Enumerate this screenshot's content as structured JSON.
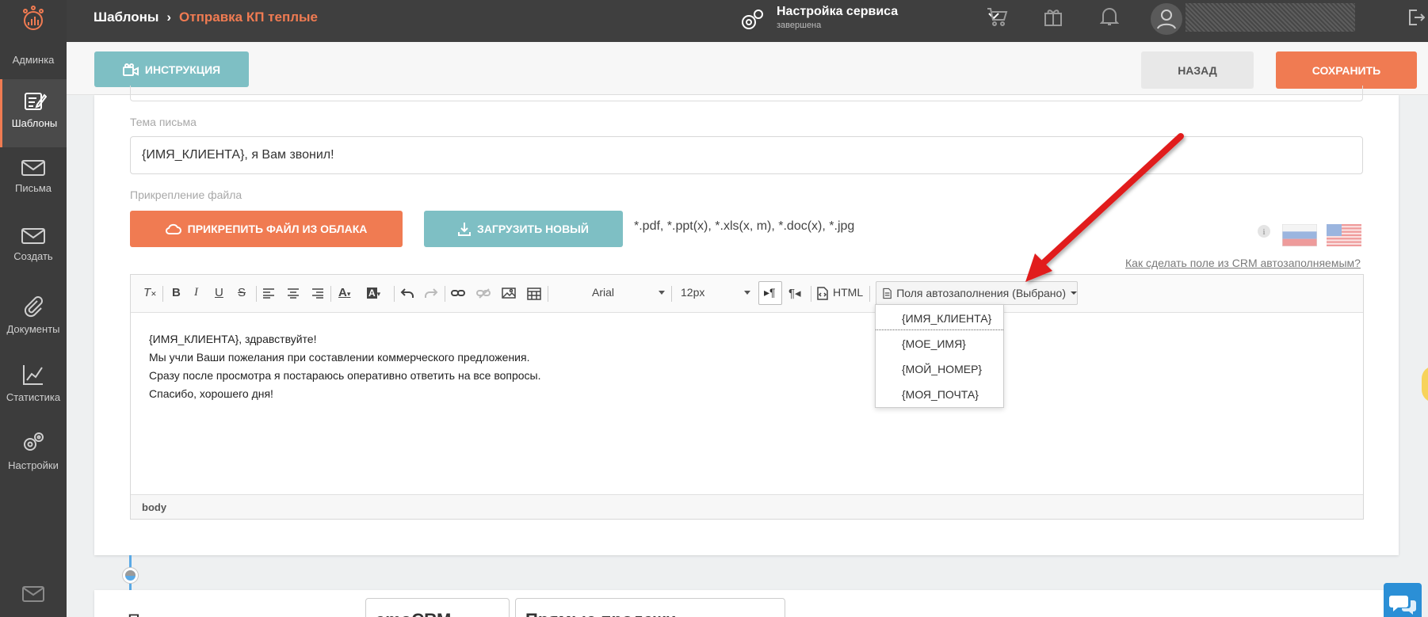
{
  "sidebar": {
    "items": [
      {
        "label": "Админка",
        "icon": "admin-logo-icon"
      },
      {
        "label": "Шаблоны",
        "icon": "templates-icon",
        "active": true
      },
      {
        "label": "Письма",
        "icon": "letters-icon"
      },
      {
        "label": "Создать",
        "icon": "create-icon"
      },
      {
        "label": "Документы",
        "icon": "documents-icon"
      },
      {
        "label": "Статистика",
        "icon": "statistics-icon"
      },
      {
        "label": "Настройки",
        "icon": "settings-icon"
      }
    ]
  },
  "header": {
    "breadcrumb_root": "Шаблоны",
    "breadcrumb_current": "Отправка КП теплые",
    "service_title": "Настройка сервиса",
    "service_status": "завершена"
  },
  "actions": {
    "instruction": "Инструкция",
    "back": "Назад",
    "save": "Сохранить"
  },
  "form": {
    "subject_label": "Тема письма",
    "subject_value": "{ИМЯ_КЛИЕНТА}, я Вам звонил!",
    "attach_label": "Прикрепление файла",
    "attach_cloud": "Прикрепить файл из облака",
    "attach_upload": "Загрузить новый",
    "allowed_ext": "*.pdf, *.ppt(x), *.xls(x, m), *.doc(x), *.jpg",
    "crm_link": "Как сделать поле из CRM автозаполняемым?"
  },
  "editor": {
    "font": "Arial",
    "size": "12px",
    "html_label": "HTML",
    "autofill_label": "Поля автозаполнения (Выбрано)",
    "body_lines": [
      "{ИМЯ_КЛИЕНТА}, здравствуйте!",
      "Мы учли Ваши пожелания при составлении коммерческого предложения.",
      "Сразу после просмотра я постараюсь оперативно ответить на все вопросы.",
      "Спасибо, хорошего дня!"
    ],
    "status_tag": "body",
    "autofill_options": [
      "{ИМЯ_КЛИЕНТА}",
      "{МОЕ_ИМЯ}",
      "{МОЙ_НОМЕР}",
      "{МОЯ_ПОЧТА}"
    ]
  },
  "next_block": {
    "label": "Перемещение по воронке",
    "pipeline": "amoCRM",
    "stage": "Прямые продажи"
  },
  "colors": {
    "accent": "#f07b52",
    "teal": "#7ebfc4",
    "sidebar": "#3c3c3c",
    "arrow": "#e02020"
  }
}
